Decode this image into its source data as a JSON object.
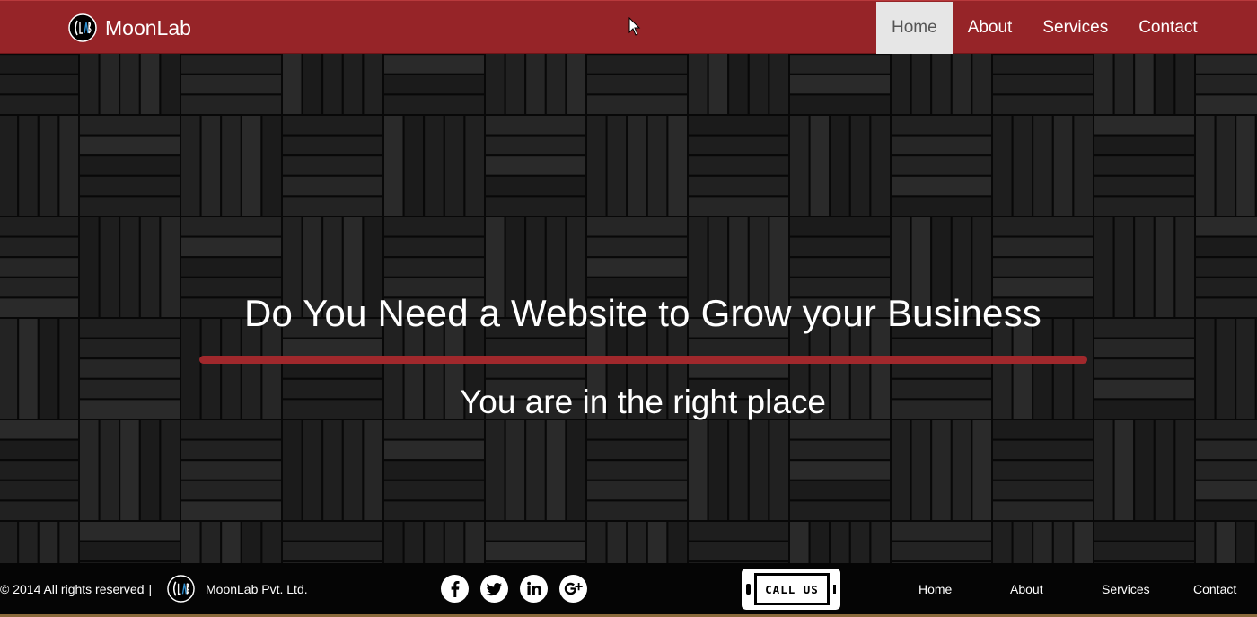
{
  "header": {
    "brand": "MoonLab",
    "nav": [
      {
        "label": "Home",
        "active": true
      },
      {
        "label": "About",
        "active": false
      },
      {
        "label": "Services",
        "active": false
      },
      {
        "label": "Contact",
        "active": false
      }
    ]
  },
  "hero": {
    "headline": "Do You Need a Website to Grow your Business",
    "subline": "You are in the right place"
  },
  "footer": {
    "copyright": "© 2014 All rights reserved",
    "separator": "|",
    "company": "MoonLab Pvt. Ltd.",
    "social": [
      "facebook-icon",
      "twitter-icon",
      "linkedin-icon",
      "google-plus-icon"
    ],
    "call_us": "CALL US",
    "nav": [
      "Home",
      "About",
      "Services",
      "Contact"
    ]
  },
  "colors": {
    "brand_red": "#962428",
    "divider_red": "#a0282c",
    "active_nav_bg": "#e6e6e6",
    "footer_bg": "#050505"
  }
}
